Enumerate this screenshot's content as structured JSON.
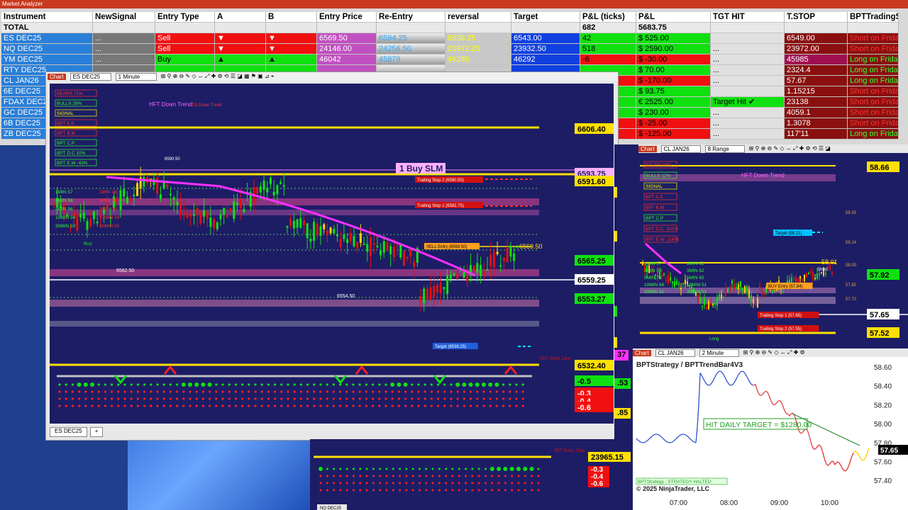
{
  "market_analyzer": {
    "title": "Market Analyzer",
    "headers": [
      "Instrument",
      "NewSignal",
      "Entry Type",
      "A",
      "B",
      "Entry Price",
      "Re-Entry",
      "reversal",
      "Target",
      "P&L (ticks)",
      "P&L",
      "TGT HIT",
      "T.STOP",
      "BPTTradingS"
    ],
    "total": {
      "label": "TOTAL",
      "pl_ticks": "682",
      "pl": "5683.75"
    },
    "rows": [
      {
        "inst": "ES DEC25",
        "ns": "...",
        "etype": "Sell",
        "a": "▼",
        "b": "▼",
        "eprice": "6569.50",
        "reentry": "6594.25",
        "rev": "6538.25",
        "target": "6543.00",
        "ticks": "42",
        "pl": "$ 525.00",
        "tgt": "",
        "tstop": "6549.00",
        "sig": "Short on Frida"
      },
      {
        "inst": "NQ DEC25",
        "ns": "...",
        "etype": "Sell",
        "a": "▼",
        "b": "▼",
        "eprice": "24146.00",
        "reentry": "24256.50",
        "rev": "23972.25",
        "target": "23932.50",
        "ticks": "518",
        "pl": "$ 2590.00",
        "tgt": "...",
        "tstop": "23972.00",
        "sig": "Short on Frida"
      },
      {
        "inst": "YM DEC25",
        "ns": "...",
        "etype": "Buy",
        "a": "▲",
        "b": "▲",
        "eprice": "46042",
        "reentry": "45879",
        "rev": "46285",
        "target": "46292",
        "ticks": "-6",
        "pl": "$ -30.00",
        "tgt": "...",
        "tstop": "45985",
        "sig": "Long on Frida"
      },
      {
        "inst": "RTY DEC25",
        "ns": "",
        "etype": "",
        "a": "",
        "b": "",
        "eprice": "",
        "reentry": "",
        "rev": "",
        "target": "",
        "ticks": "",
        "pl": "$ 70.00",
        "tgt": "...",
        "tstop": "2324.4",
        "sig": "Long on Frida"
      },
      {
        "inst": "CL JAN26",
        "ns": "",
        "etype": "",
        "a": "",
        "b": "",
        "eprice": "",
        "reentry": "",
        "rev": "",
        "target": "",
        "ticks": "",
        "pl": "$ -170.00",
        "tgt": "...",
        "tstop": "57.67",
        "sig": "Long on Frida"
      },
      {
        "inst": "6E DEC25",
        "ns": "",
        "etype": "",
        "a": "",
        "b": "",
        "eprice": "",
        "reentry": "",
        "rev": "",
        "target": "",
        "ticks": "",
        "pl": "$ 93.75",
        "tgt": "",
        "tstop": "1.15215",
        "sig": "Short on Frida"
      },
      {
        "inst": "FDAX DEC2",
        "ns": "",
        "etype": "",
        "a": "",
        "b": "",
        "eprice": "",
        "reentry": "",
        "rev": "",
        "target": "",
        "ticks": "",
        "pl": "€ 2525.00",
        "tgt": "Target Hit  ✔",
        "tstop": "23138",
        "sig": "Short on Frida"
      },
      {
        "inst": "GC DEC25",
        "ns": "",
        "etype": "",
        "a": "",
        "b": "",
        "eprice": "",
        "reentry": "",
        "rev": "",
        "target": "",
        "ticks": "",
        "pl": "$ 230.00",
        "tgt": "...",
        "tstop": "4059.1",
        "sig": "Short on Frida"
      },
      {
        "inst": "6B DEC25",
        "ns": "",
        "etype": "",
        "a": "",
        "b": "",
        "eprice": "",
        "reentry": "",
        "rev": "",
        "target": "",
        "ticks": "",
        "pl": "$ -25.00",
        "tgt": "...",
        "tstop": "1.3078",
        "sig": "Short on Frida"
      },
      {
        "inst": "ZB DEC25",
        "ns": "",
        "etype": "",
        "a": "",
        "b": "",
        "eprice": "",
        "reentry": "",
        "rev": "",
        "target": "",
        "ticks": "",
        "pl": "$ -125.00",
        "tgt": "...",
        "tstop": "117'11",
        "sig": "Long on Frida"
      }
    ]
  },
  "main_chart": {
    "tab": "Chart",
    "instrument": "ES DEC25",
    "interval": "1 Minute",
    "bottom_tab": "ES DEC25",
    "title": "HFT Down Trend",
    "title2": "TG Down Trend",
    "order_label": "1 Buy SLM",
    "prices": [
      "6606.40",
      "6593.75",
      "6591.60",
      "6565.25",
      "6559.25",
      "6553.27",
      "6532.40",
      "-0.5",
      "-0.3",
      "-0.4",
      "-0.6"
    ],
    "trail2": "Trailing Stop 2 (6590.50)",
    "trail1": "Trailing Stop 1 (6582.75)",
    "sell_entry": "SELL Entry (6569.50)",
    "target_lbl": "Target (6538.25)",
    "entry_price_label": "6569.50",
    "low_label": "6554.50",
    "low2_label": "6562.50",
    "high_label": "6590.50",
    "buy": "Buy",
    "entry_zone": "BPT Entry Zone",
    "indicators": [
      "BEARS 71%",
      "BULLS 29%",
      "SIGNAL",
      "BPT A.S",
      "BPT B.M",
      "BPT C.P",
      "BPT D.C 10%",
      "BPT E.W -43%"
    ],
    "mtf": [
      "1MIN 57",
      "3MIN 58",
      "5MIN 56",
      "10MIN 54",
      "30MIN 53"
    ],
    "mtf2": [
      "1MIN 38",
      "3MIN 36",
      "5MIN 36",
      "10MIN 34",
      "30MIN 35"
    ],
    "side_prices": [
      "35",
      ".65",
      ".25",
      ".50",
      ".53",
      ".85",
      "37"
    ]
  },
  "cl_chart": {
    "tab": "Chart",
    "instrument": "CL JAN26",
    "interval": "8 Range",
    "title": "HFT Down Trend",
    "prices": [
      "58.66",
      "57.92",
      "57.65",
      "57.52"
    ],
    "target": "Target (58.21)",
    "buy_entry": "BUY Entry (57.84)",
    "trail1": "Trailing Stop 1 (57.65)",
    "trail2": "Trailing Stop 2 (57.55)",
    "short": "Short",
    "long": "Long",
    "price_label": "58.01",
    "indicators": [
      "BEARS 88%",
      "BULLS 12%",
      "SIGNAL",
      "BPT A.S",
      "BPT B.M",
      "BPT C.P",
      "BPT D.C -100%",
      "BPT E.W -100%"
    ],
    "mtf": [
      "1MIN 57",
      "3MIN 59",
      "5MIN 76",
      "10MIN 66",
      "30MIN 52"
    ],
    "mtf2": [
      "3MIN 62",
      "3MIN 62",
      "5MIN 65",
      "10MIN 51",
      "30MIN 51"
    ],
    "levels": [
      "58.35",
      "58.14",
      "58.00",
      "57.85",
      "57.70"
    ]
  },
  "strategy_chart": {
    "tab": "Chart",
    "instrument": "CL JAN26",
    "interval": "2 Minute",
    "title": "BPTStrategy / BPTTrendBar4V3",
    "hit_label": "HIT DAILY TARGET = $1280.00",
    "halted": "BPTStrategy : STRATEGY HALTED",
    "copyright": "© 2025 NinjaTrader, LLC",
    "last_price": "57.65",
    "y_ticks": [
      "58.60",
      "58.40",
      "58.20",
      "58.00",
      "57.80",
      "57.60",
      "57.40"
    ],
    "x_ticks": [
      "07:00",
      "08:00",
      "09:00",
      "10:00"
    ]
  },
  "bottom_chart": {
    "price": "23965.15",
    "values": [
      "-0.3",
      "-0.4",
      "-0.6"
    ],
    "entry_zone": "BPT Entry Zone",
    "tab": "NQ DEC25"
  },
  "colors": {
    "bg": "#1d1d66",
    "yellow": "#ffe000",
    "magenta": "#ff30ff",
    "green": "#10e010",
    "red": "#f01010"
  }
}
